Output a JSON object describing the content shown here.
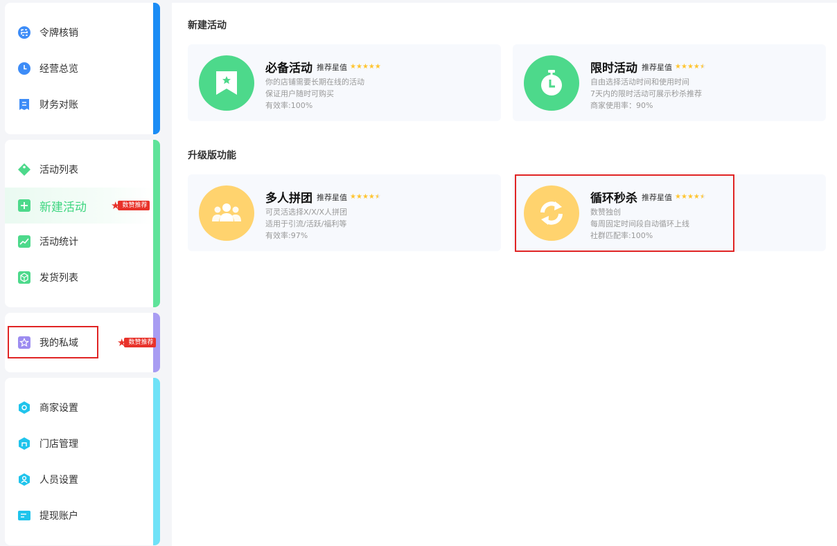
{
  "sidebar": {
    "groups": [
      {
        "accent": "#1b8cf5",
        "items": [
          {
            "label": "令牌核销",
            "icon": "scan-icon"
          },
          {
            "label": "经营总览",
            "icon": "clock-icon"
          },
          {
            "label": "财务对账",
            "icon": "receipt-icon"
          }
        ]
      },
      {
        "accent": "#5fe39a",
        "items": [
          {
            "label": "活动列表",
            "icon": "tag-icon"
          },
          {
            "label": "新建活动",
            "icon": "plus-icon",
            "active": true,
            "badge": "数赞推荐"
          },
          {
            "label": "活动统计",
            "icon": "chart-icon"
          },
          {
            "label": "发货列表",
            "icon": "box-icon"
          }
        ]
      },
      {
        "accent": "#a89cf2",
        "items": [
          {
            "label": "我的私域",
            "icon": "star-icon",
            "badge": "数赞推荐"
          }
        ]
      },
      {
        "accent": "#6fe2f7",
        "items": [
          {
            "label": "商家设置",
            "icon": "settings-icon"
          },
          {
            "label": "门店管理",
            "icon": "store-icon"
          },
          {
            "label": "人员设置",
            "icon": "user-icon"
          },
          {
            "label": "提现账户",
            "icon": "card-icon"
          }
        ]
      }
    ]
  },
  "main": {
    "sections": [
      {
        "title": "新建活动",
        "cards": [
          {
            "name": "必备活动",
            "rec_label": "推荐星值",
            "stars": 5,
            "icon": "bookmark-star-icon",
            "color": "green",
            "lines": [
              "你的店铺需要长期在线的活动",
              "保证用户随时可购买",
              "有效率:100%"
            ]
          },
          {
            "name": "限时活动",
            "rec_label": "推荐星值",
            "stars": 4.5,
            "icon": "stopwatch-icon",
            "color": "green",
            "lines": [
              "自由选择活动时间和使用时间",
              "7天内的限时活动可展示秒杀推荐",
              "商家使用率：90%"
            ]
          }
        ]
      },
      {
        "title": "升级版功能",
        "cards": [
          {
            "name": "多人拼团",
            "rec_label": "推荐星值",
            "stars": 4.5,
            "icon": "group-icon",
            "color": "yellow",
            "lines": [
              "可灵活选择X/X/X人拼团",
              "适用于引流/活跃/福利等",
              "有效率:97%"
            ]
          },
          {
            "name": "循环秒杀",
            "rec_label": "推荐星值",
            "stars": 4.5,
            "icon": "refresh-icon",
            "color": "yellow",
            "lines": [
              "数赞独创",
              "每周固定时间段自动循环上线",
              "社群匹配率:100%"
            ]
          }
        ]
      }
    ]
  }
}
